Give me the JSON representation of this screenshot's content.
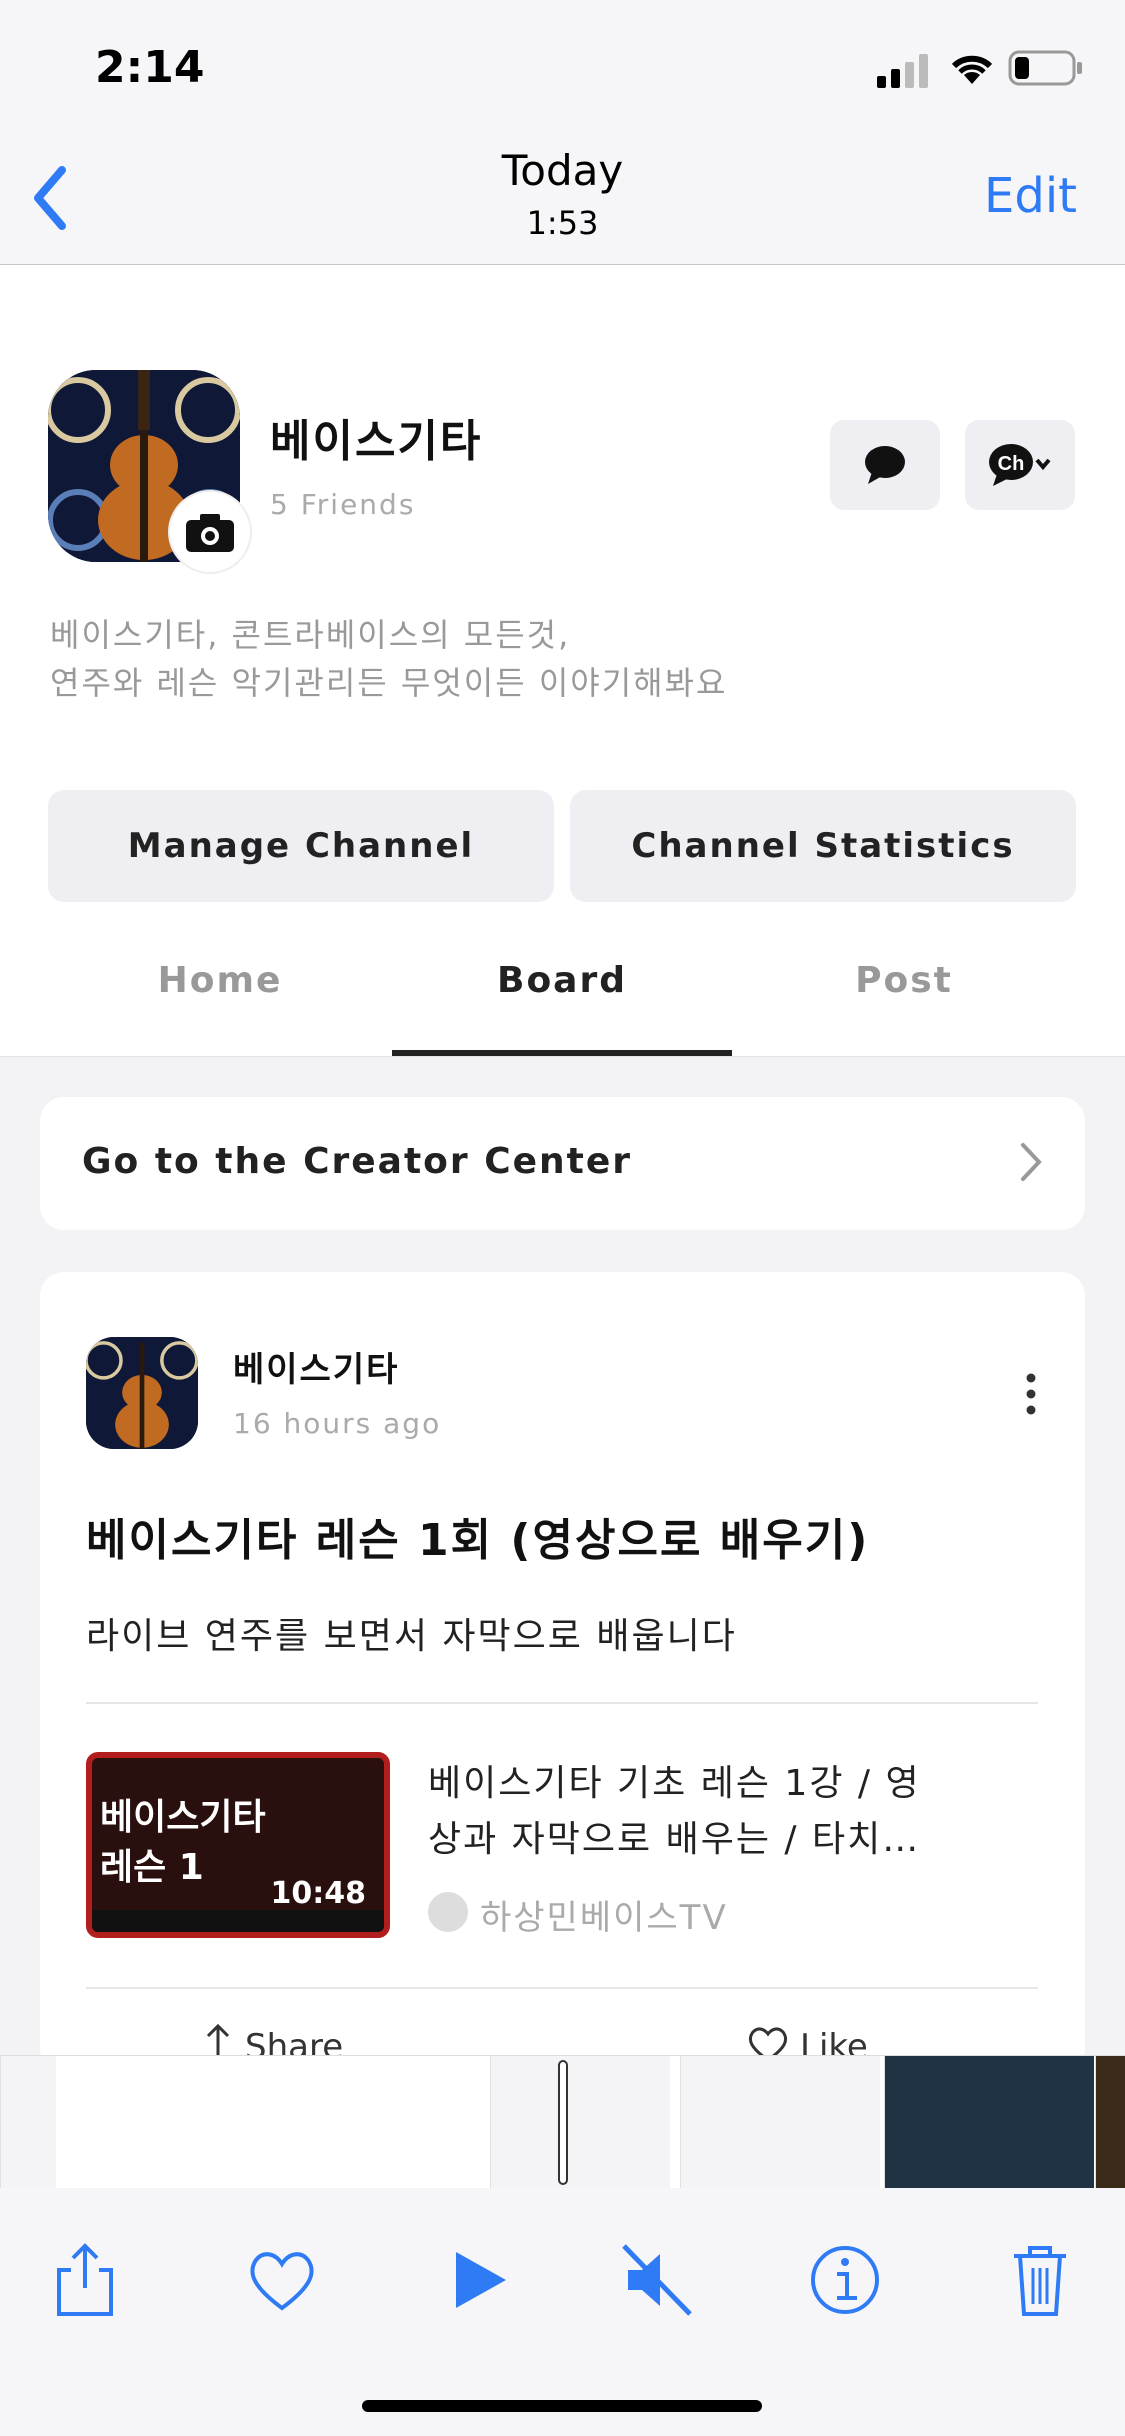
{
  "status": {
    "time": "2:14"
  },
  "nav": {
    "title": "Today",
    "subtitle": "1:53",
    "edit": "Edit"
  },
  "profile": {
    "name": "베이스기타",
    "friends": "5 Friends",
    "desc_line1": "베이스기타, 콘트라베이스의 모든것,",
    "desc_line2": "연주와 레슨 악기관리든 무엇이든 이야기해봐요",
    "manage_btn": "Manage Channel",
    "stats_btn": "Channel Statistics"
  },
  "tabs": [
    {
      "label": "Home",
      "active": false
    },
    {
      "label": "Board",
      "active": true
    },
    {
      "label": "Post",
      "active": false
    }
  ],
  "creator_center": "Go to the Creator Center",
  "post": {
    "author": "베이스기타",
    "time": "16 hours ago",
    "title": "베이스기타 레슨 1회 (영상으로 배우기)",
    "body": "라이브 연주를 보면서 자막으로 배웁니다",
    "link": {
      "thumb_line1": "베이스기타",
      "thumb_line2": "레슨 1",
      "duration": "10:48",
      "title_line1": "베이스기타 기초 레슨 1강 / 영",
      "title_line2": "상과 자막으로 배우는 / 타치…",
      "source": "하상민베이스TV"
    },
    "share": "Share",
    "like": "Like"
  },
  "colors": {
    "accent": "#2f7bf5",
    "thumb_border": "#b21e1e"
  },
  "toolbar": [
    "share-icon",
    "heart-icon",
    "play-icon",
    "mute-icon",
    "info-icon",
    "trash-icon"
  ]
}
